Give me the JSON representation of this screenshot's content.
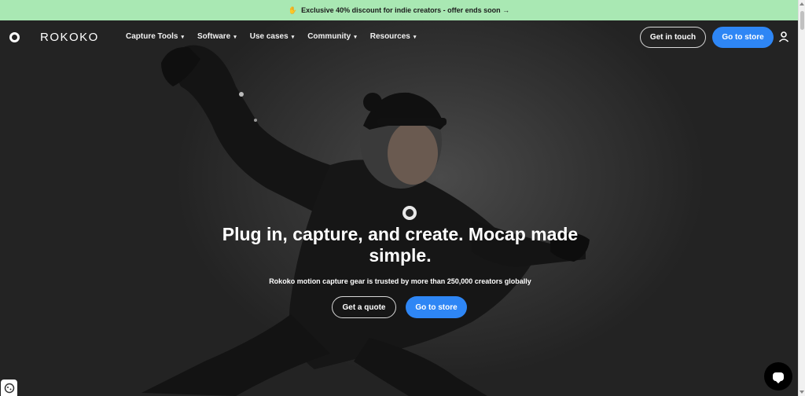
{
  "promo": {
    "icon": "hand-icon",
    "text": "Exclusive 40% discount for indie creators - offer ends soon →"
  },
  "nav": {
    "brand": "ROKOKO",
    "items": [
      {
        "label": "Capture Tools"
      },
      {
        "label": "Software"
      },
      {
        "label": "Use cases"
      },
      {
        "label": "Community"
      },
      {
        "label": "Resources"
      }
    ],
    "contact_label": "Get in touch",
    "store_label": "Go to store"
  },
  "hero": {
    "headline": "Plug in, capture, and create. Mocap made simple.",
    "subline": "Rokoko motion capture gear is trusted by more than 250,000 creators globally",
    "quote_label": "Get a quote",
    "store_label": "Go to store"
  },
  "colors": {
    "promo_bg": "#a9e8b3",
    "accent": "#2e86f5",
    "hero_bg": "#2a2a2a"
  }
}
